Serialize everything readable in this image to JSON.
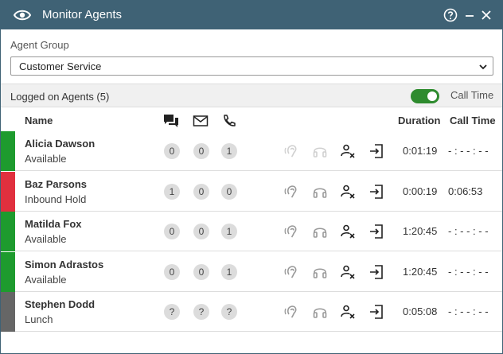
{
  "window": {
    "title": "Monitor Agents",
    "icons": [
      "eye-icon",
      "help-icon",
      "minimize-icon",
      "close-icon"
    ],
    "colors": {
      "titlebar": "#3f6275"
    }
  },
  "agent_group": {
    "label": "Agent Group",
    "selected": "Customer Service"
  },
  "agents_bar": {
    "label": "Logged on Agents (5)",
    "toggle_label": "Call Time",
    "toggle_on": true
  },
  "columns": {
    "name": "Name",
    "duration": "Duration",
    "call_time": "Call Time",
    "icons": [
      "chat-icon",
      "mail-icon",
      "phone-icon"
    ]
  },
  "actions": [
    "listen-icon",
    "headset-icon",
    "logoff-agent-icon",
    "transfer-icon"
  ],
  "agents": [
    {
      "name": "Alicia Dawson",
      "status": "Available",
      "status_color": "#1e9b2e",
      "chat": "0",
      "mail": "0",
      "phone": "1",
      "duration": "0:01:19",
      "call_time": "- : - - : - -"
    },
    {
      "name": "Baz Parsons",
      "status": "Inbound Hold",
      "status_color": "#e0303e",
      "chat": "1",
      "mail": "0",
      "phone": "0",
      "duration": "0:00:19",
      "call_time": "0:06:53"
    },
    {
      "name": "Matilda Fox",
      "status": "Available",
      "status_color": "#1e9b2e",
      "chat": "0",
      "mail": "0",
      "phone": "1",
      "duration": "1:20:45",
      "call_time": "- : - - : - -"
    },
    {
      "name": "Simon Adrastos",
      "status": "Available",
      "status_color": "#1e9b2e",
      "chat": "0",
      "mail": "0",
      "phone": "1",
      "duration": "1:20:45",
      "call_time": "- : - - : - -"
    },
    {
      "name": "Stephen Dodd",
      "status": "Lunch",
      "status_color": "#666666",
      "chat": "?",
      "mail": "?",
      "phone": "?",
      "duration": "0:05:08",
      "call_time": "- : - - : - -"
    }
  ]
}
